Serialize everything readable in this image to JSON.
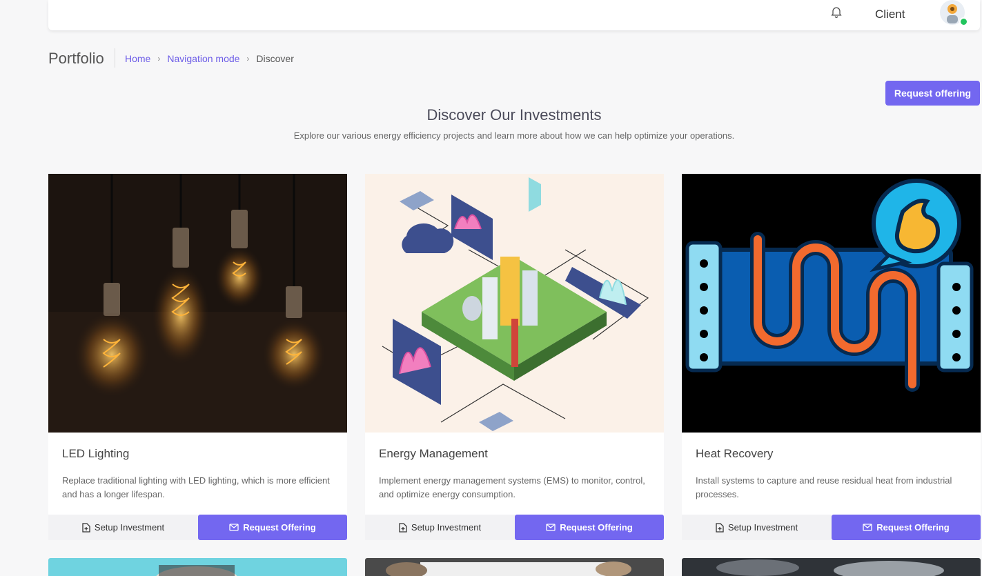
{
  "header": {
    "user_label": "Client"
  },
  "page": {
    "title": "Portfolio"
  },
  "breadcrumb": {
    "items": [
      "Home",
      "Navigation mode"
    ],
    "current": "Discover"
  },
  "actions": {
    "request_offering_top": "Request offering"
  },
  "hero": {
    "title": "Discover Our Investments",
    "subtitle": "Explore our various energy efficiency projects and learn more about how we can help optimize your operations."
  },
  "cards": [
    {
      "title": "LED Lighting",
      "description": "Replace traditional lighting with LED lighting, which is more efficient and has a longer lifespan.",
      "setup_label": "Setup Investment",
      "request_label": "Request Offering"
    },
    {
      "title": "Energy Management",
      "description": "Implement energy management systems (EMS) to monitor, control, and optimize energy consumption.",
      "setup_label": "Setup Investment",
      "request_label": "Request Offering"
    },
    {
      "title": "Heat Recovery",
      "description": "Install systems to capture and reuse residual heat from industrial processes.",
      "setup_label": "Setup Investment",
      "request_label": "Request Offering"
    }
  ],
  "colors": {
    "accent": "#7367f0",
    "online": "#22c55e",
    "background": "#f7f7f8"
  }
}
